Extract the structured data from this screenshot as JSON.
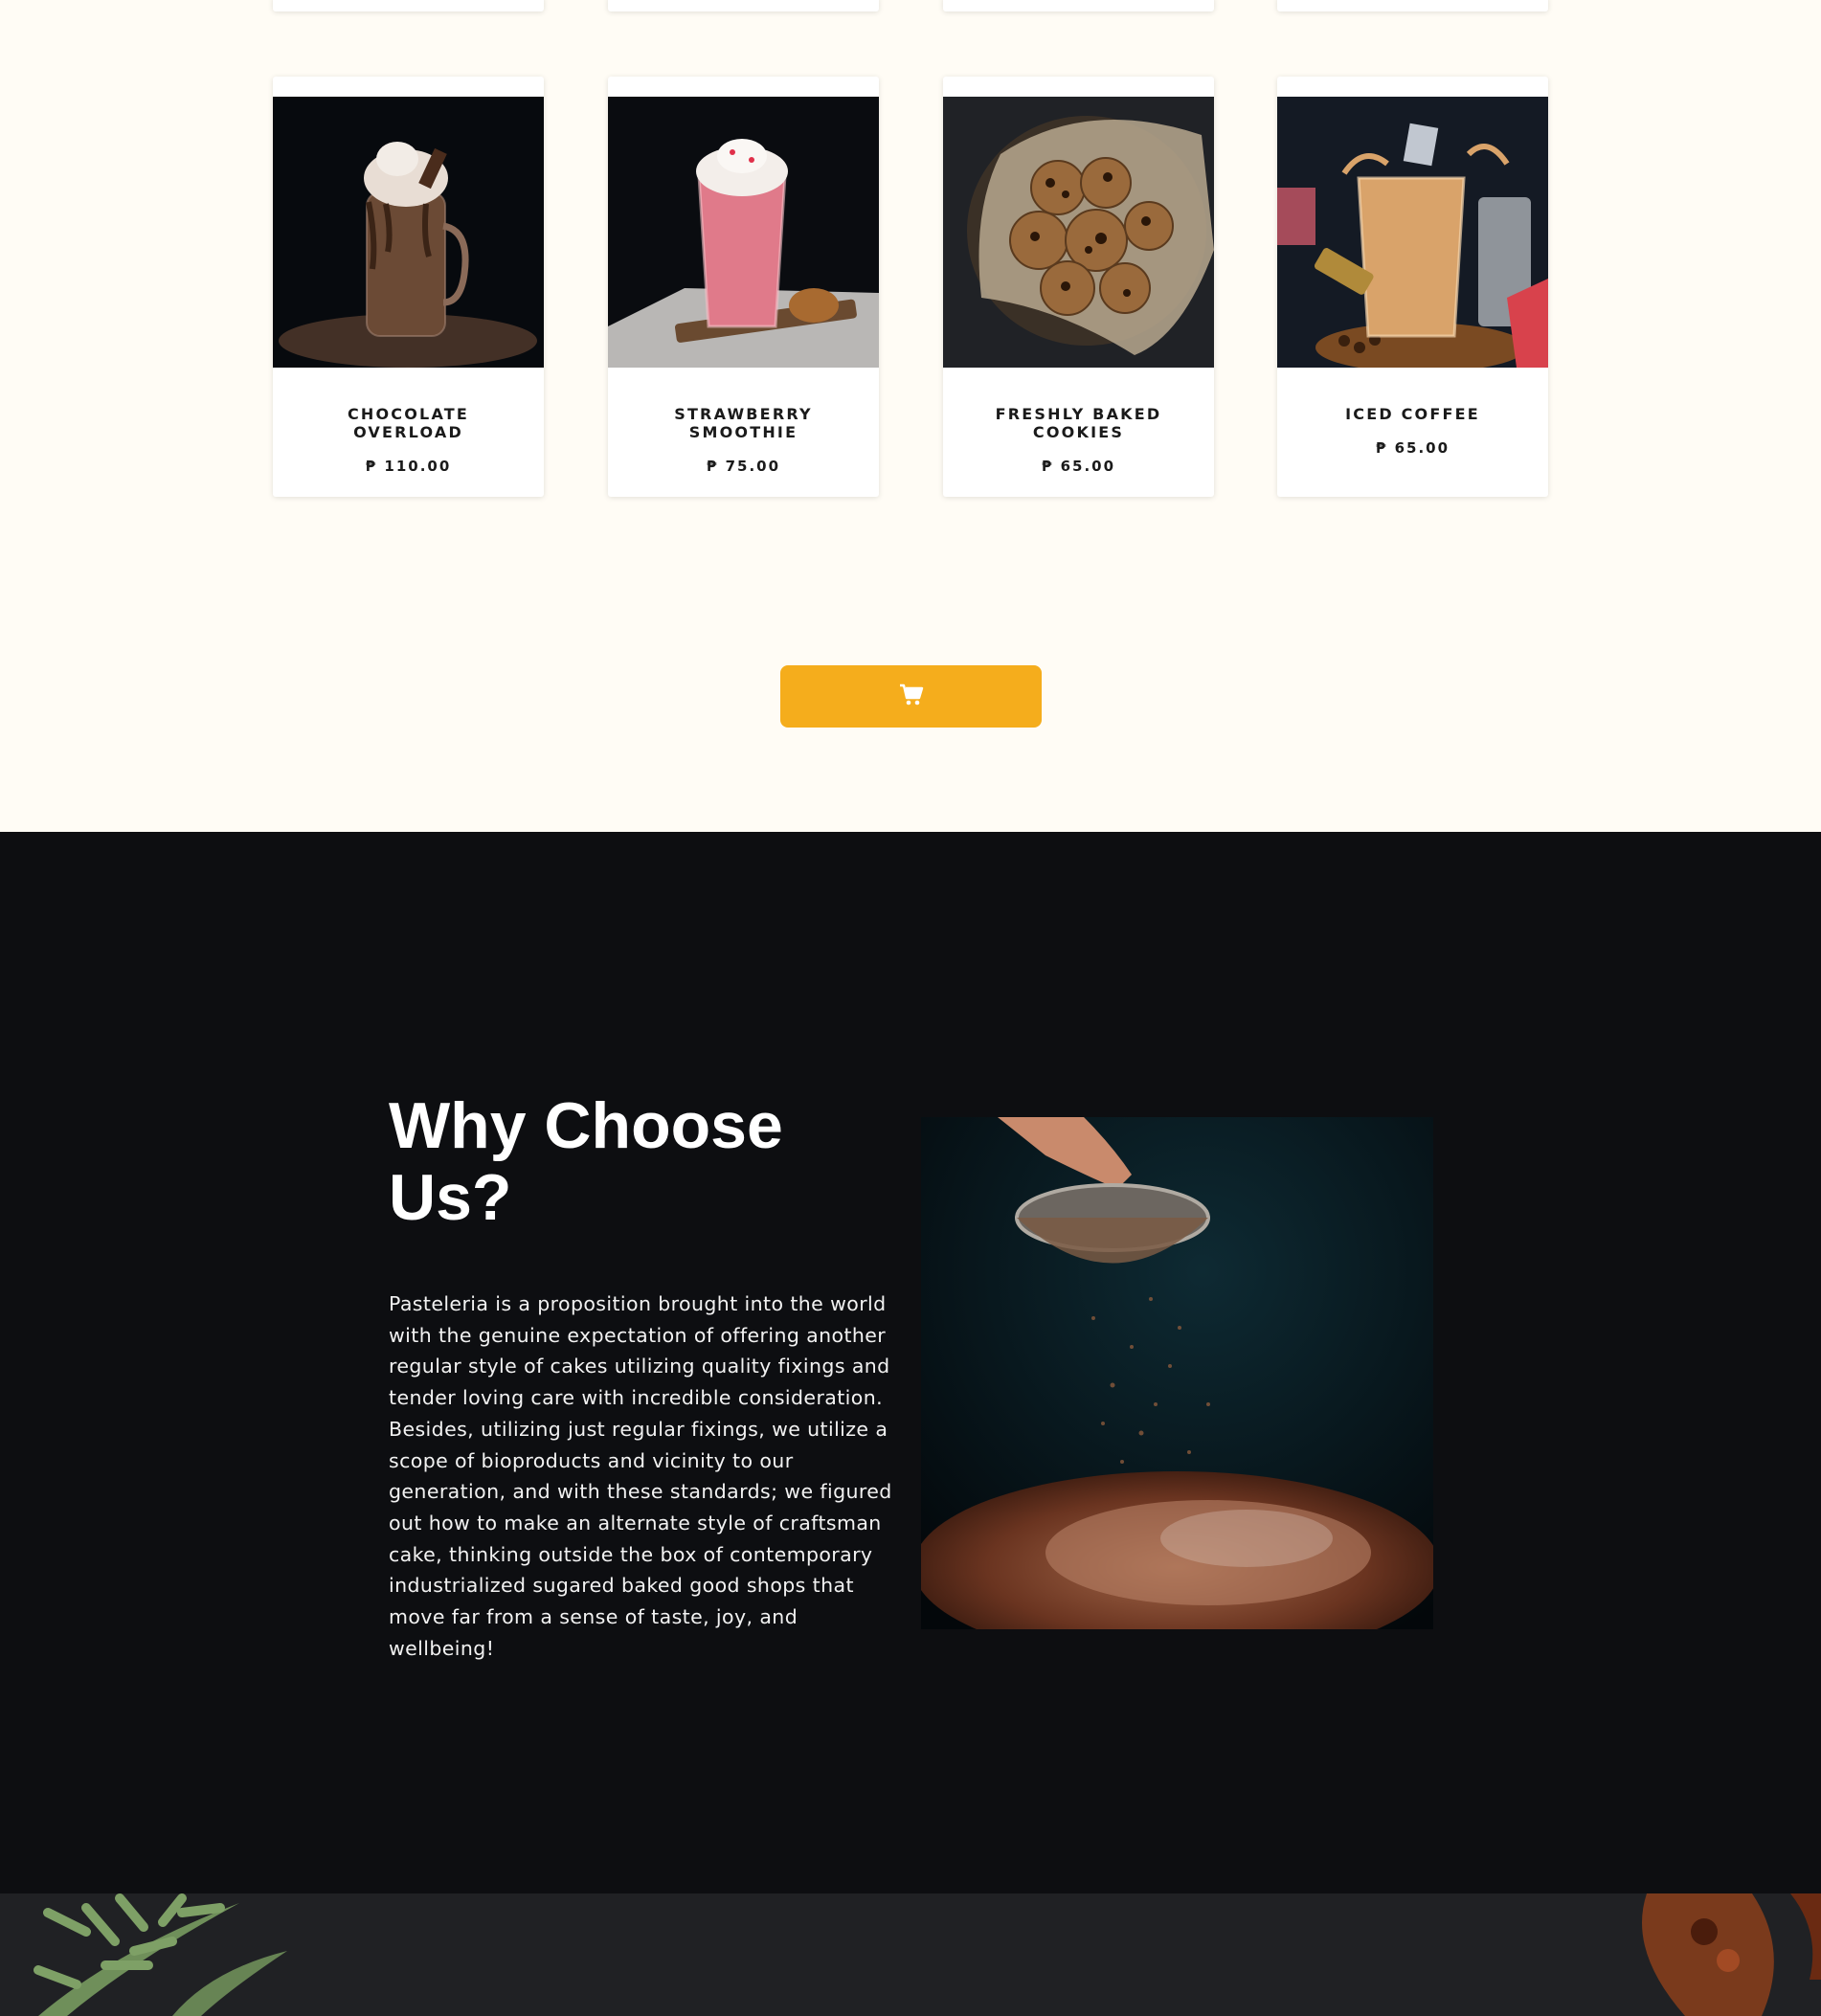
{
  "products": [
    {
      "name": "CHOCOLATE\nOVERLOAD",
      "price": "₱ 110.00",
      "image": "chocolate-shake-photo"
    },
    {
      "name": "STRAWBERRY\nSMOOTHIE",
      "price": "₱ 75.00",
      "image": "strawberry-smoothie-photo"
    },
    {
      "name": "FRESHLY BAKED\nCOOKIES",
      "price": "₱ 65.00",
      "image": "cookies-photo"
    },
    {
      "name": "ICED COFFEE",
      "price": "₱ 65.00",
      "image": "iced-coffee-photo"
    }
  ],
  "cart_button": {
    "icon": "shopping-cart-icon",
    "color": "#f5ad1c"
  },
  "why": {
    "title": "Why Choose Us?",
    "body": "Pasteleria is a proposition brought into the world with the genuine expectation of offering another regular style of cakes utilizing quality fixings and tender loving care with incredible consideration. Besides, utilizing just regular fixings, we utilize a scope of bioproducts and vicinity to our generation, and with these standards; we figured out how to make an alternate style of craftsman cake, thinking outside the box of contemporary industrialized sugared baked good shops that move far from a sense of taste, joy, and wellbeing!",
    "image": "cocoa-sifting-photo"
  },
  "colors": {
    "page_bg": "#fffcf5",
    "dark_bg": "#0d0e11",
    "accent": "#f5ad1c"
  }
}
